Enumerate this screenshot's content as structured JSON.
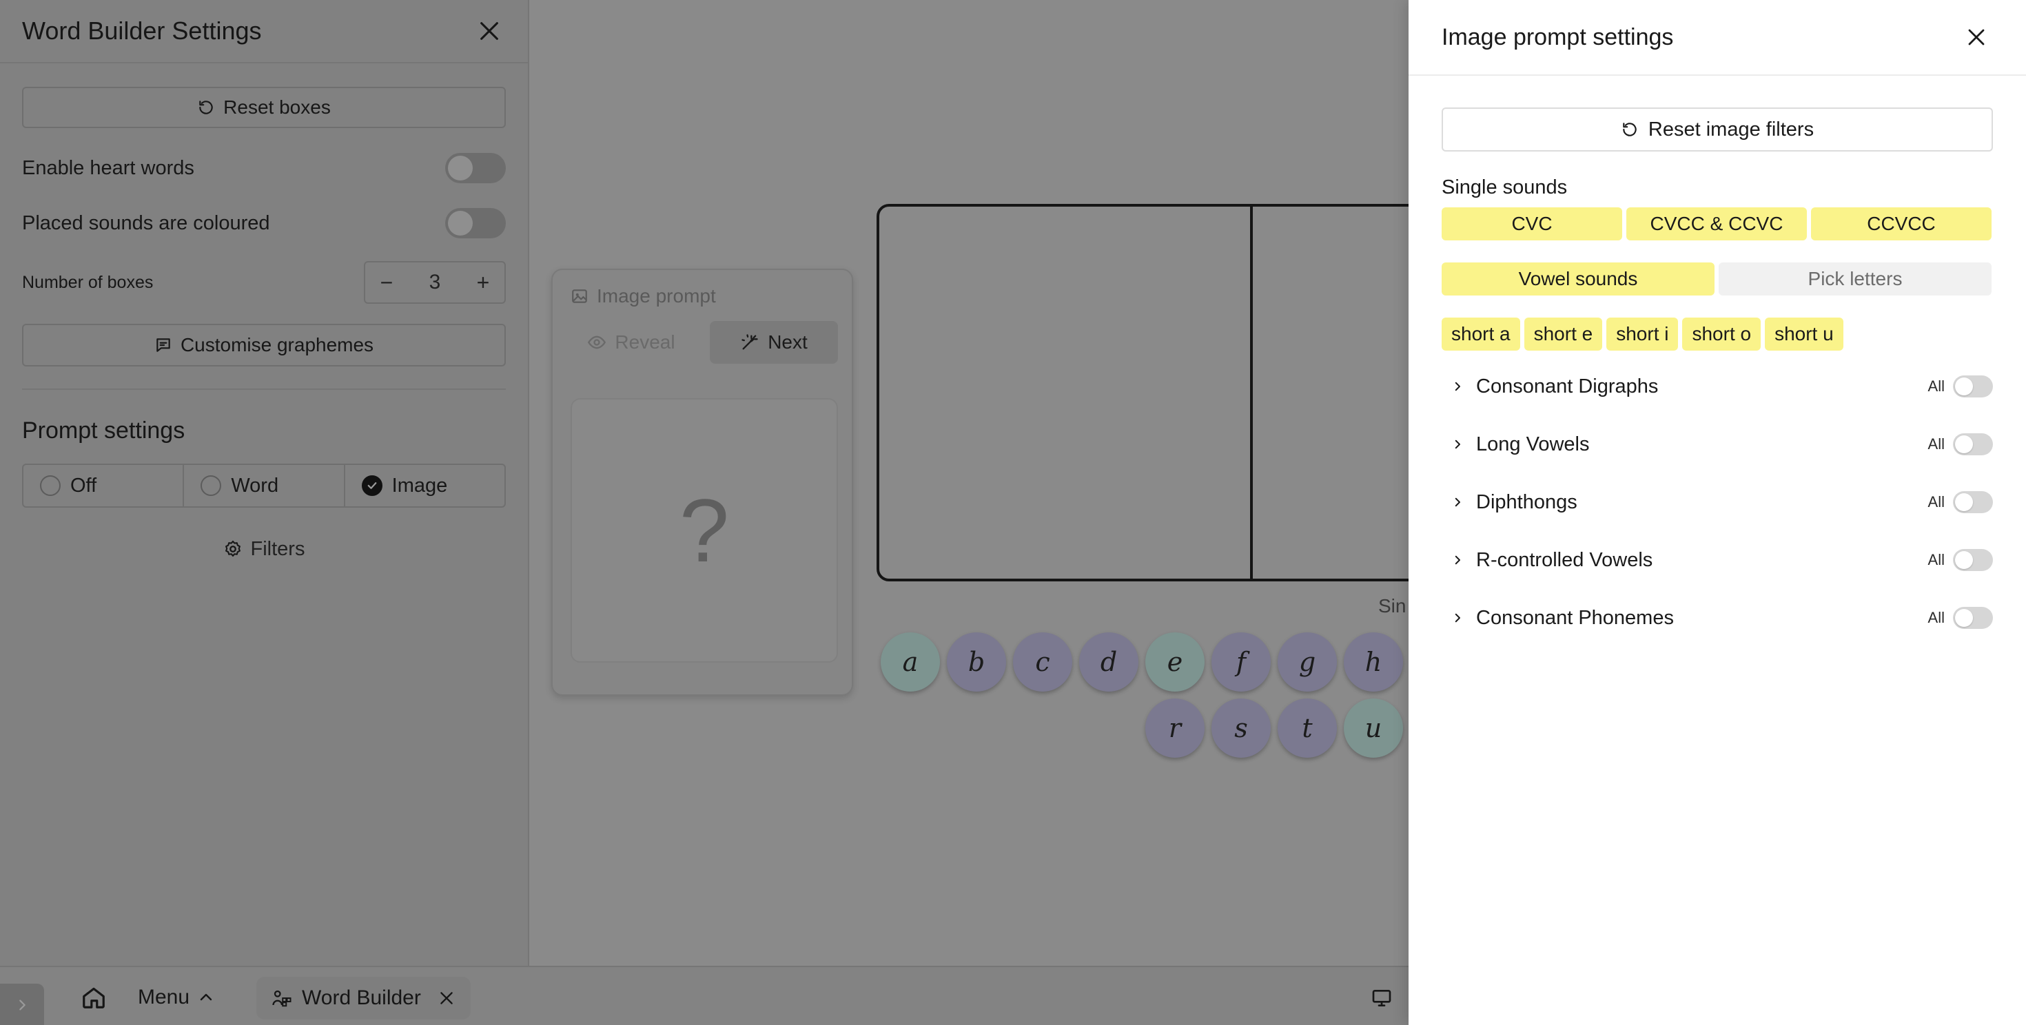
{
  "settings_panel": {
    "title": "Word Builder Settings",
    "reset_boxes_label": "Reset boxes",
    "enable_heart_words_label": "Enable heart words",
    "placed_sounds_coloured_label": "Placed sounds are coloured",
    "number_of_boxes_label": "Number of boxes",
    "number_of_boxes_value": "3",
    "customise_graphemes_label": "Customise graphemes",
    "prompt_settings_title": "Prompt settings",
    "prompt_options": [
      {
        "label": "Off",
        "checked": false
      },
      {
        "label": "Word",
        "checked": false
      },
      {
        "label": "Image",
        "checked": true
      }
    ],
    "filters_label": "Filters"
  },
  "image_prompt_card": {
    "title": "Image prompt",
    "reveal_label": "Reveal",
    "next_label": "Next",
    "placeholder": "?"
  },
  "workspace": {
    "box_count": 3,
    "partial_label": "Sin",
    "tiles_row1": [
      "a",
      "b",
      "c",
      "d",
      "e",
      "f",
      "g",
      "h"
    ],
    "tiles_row2": [
      "r",
      "s",
      "t",
      "u"
    ]
  },
  "bottom_bar": {
    "menu_label": "Menu",
    "app_tab_label": "Word Builder"
  },
  "drawer": {
    "title": "Image prompt settings",
    "reset_filters_label": "Reset image filters",
    "single_sounds_label": "Single sounds",
    "word_patterns": [
      "CVC",
      "CVCC & CCVC",
      "CCVCC"
    ],
    "mode_options": [
      {
        "label": "Vowel sounds",
        "active": true
      },
      {
        "label": "Pick letters",
        "active": false
      }
    ],
    "vowel_chips": [
      "short a",
      "short e",
      "short i",
      "short o",
      "short u"
    ],
    "groups": [
      {
        "label": "Consonant Digraphs",
        "all_label": "All"
      },
      {
        "label": "Long Vowels",
        "all_label": "All"
      },
      {
        "label": "Diphthongs",
        "all_label": "All"
      },
      {
        "label": "R-controlled Vowels",
        "all_label": "All"
      },
      {
        "label": "Consonant Phonemes",
        "all_label": "All"
      }
    ]
  },
  "colors": {
    "chip_yellow": "#faf38a",
    "overlay_grey": "#8a8a8a",
    "consonant_tile": "#7b7990",
    "vowel_tile": "#7d9490"
  }
}
